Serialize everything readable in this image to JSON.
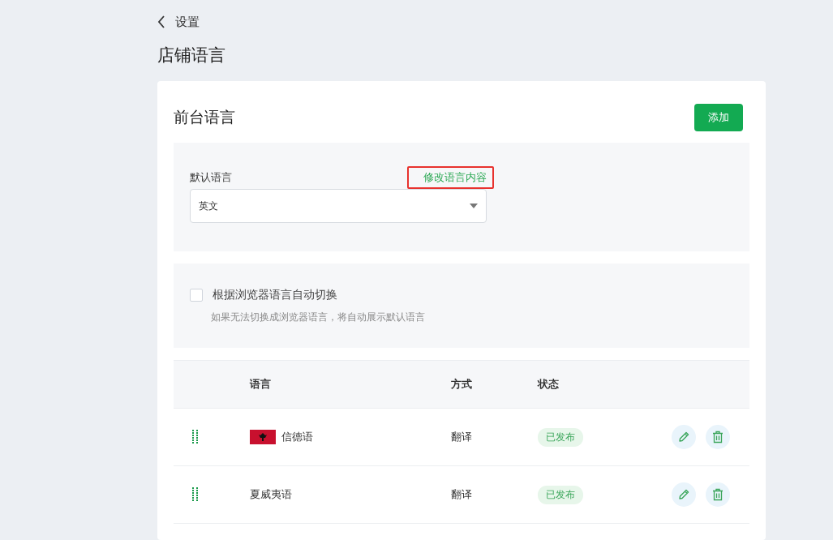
{
  "back": {
    "label": "设置"
  },
  "page_title": "店铺语言",
  "section": {
    "title": "前台语言",
    "add_button": "添加"
  },
  "default_language": {
    "label": "默认语言",
    "link": "修改语言内容",
    "link_highlighted": true,
    "value": "英文"
  },
  "auto_switch": {
    "label": "根据浏览器语言自动切换",
    "checked": false,
    "hint": "如果无法切换成浏览器语言，将自动展示默认语言"
  },
  "table": {
    "columns": [
      "语言",
      "方式",
      "状态"
    ],
    "rows": [
      {
        "flag": true,
        "language": "信德语",
        "method": "翻译",
        "status": "已发布"
      },
      {
        "flag": false,
        "language": "夏威夷语",
        "method": "翻译",
        "status": "已发布"
      }
    ]
  }
}
